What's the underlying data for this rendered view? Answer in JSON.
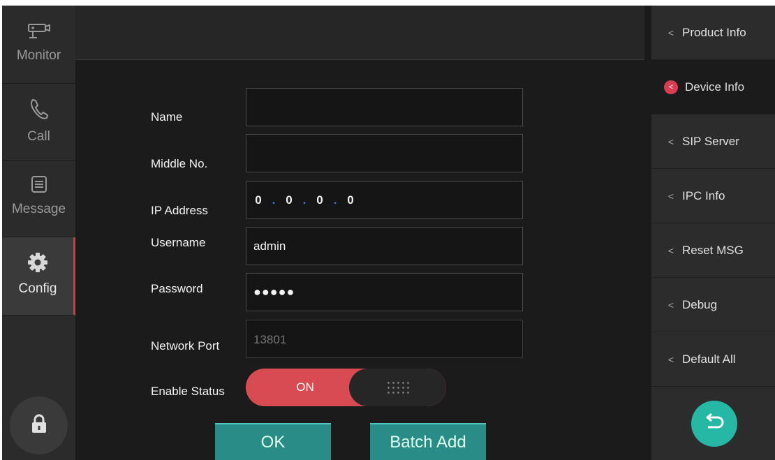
{
  "leftnav": {
    "items": [
      {
        "label": "Monitor",
        "icon": "camera-icon"
      },
      {
        "label": "Call",
        "icon": "phone-icon"
      },
      {
        "label": "Message",
        "icon": "message-icon"
      },
      {
        "label": "Config",
        "icon": "gear-icon"
      }
    ],
    "active": "Config",
    "lock_icon": "lock-icon"
  },
  "form": {
    "name": {
      "label": "Name",
      "value": ""
    },
    "middle_no": {
      "label": "Middle No.",
      "value": ""
    },
    "ip": {
      "label": "IP Address",
      "segments": [
        "0",
        "0",
        "0",
        "0"
      ]
    },
    "username": {
      "label": "Username",
      "value": "admin"
    },
    "password": {
      "label": "Password",
      "value": "●●●●●"
    },
    "port": {
      "label": "Network Port",
      "placeholder": "13801"
    },
    "enable": {
      "label": "Enable Status",
      "state": "ON"
    },
    "ok_label": "OK",
    "batch_label": "Batch Add"
  },
  "rightnav": {
    "items": [
      {
        "label": "Product Info"
      },
      {
        "label": "Device Info"
      },
      {
        "label": "SIP Server"
      },
      {
        "label": "IPC Info"
      },
      {
        "label": "Reset MSG"
      },
      {
        "label": "Debug"
      },
      {
        "label": "Default All"
      }
    ],
    "active": "Device Info",
    "back_icon": "back-arrow-icon"
  },
  "colors": {
    "accent_red": "#d94b52",
    "teal": "#2a8c86",
    "back_teal": "#27b7a5",
    "bg": "#1b1b1b"
  }
}
